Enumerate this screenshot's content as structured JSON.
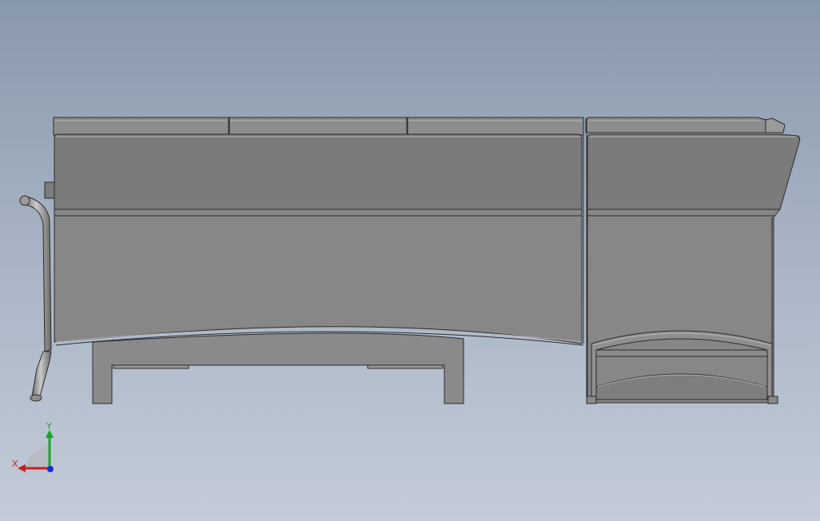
{
  "viewport": {
    "background_top": "#8898ab",
    "background_bottom": "#c3cbd8"
  },
  "model": {
    "name": "sectional-sofa",
    "view": "front",
    "body_color": "#878787",
    "back_color": "#7b7b7b",
    "edge_color": "#2b2b2b",
    "highlight_color": "#b9b9b9"
  },
  "triad": {
    "x_label": "X",
    "y_label": "Y",
    "x_color": "#c8201e",
    "y_color": "#17a52a",
    "z_color": "#1b2ad6"
  }
}
